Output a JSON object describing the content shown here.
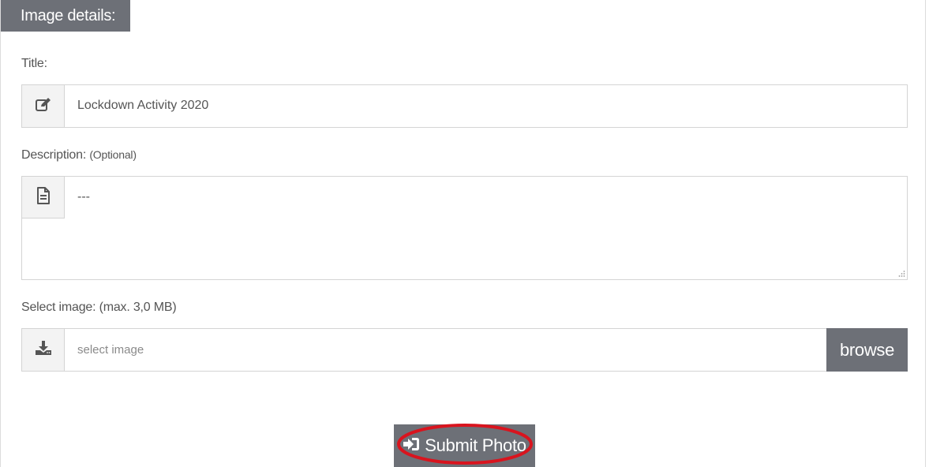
{
  "section": {
    "title": "Image details:"
  },
  "title_field": {
    "label": "Title:",
    "value": "Lockdown Activity 2020",
    "icon": "edit-icon"
  },
  "description_field": {
    "label": "Description:",
    "optional_label": "(Optional)",
    "value": "---",
    "icon": "document-icon"
  },
  "image_field": {
    "label": "Select image: (max. 3,0 MB)",
    "placeholder": "select image",
    "icon": "download-icon",
    "browse_label": "browse"
  },
  "submit": {
    "label": "Submit Photo",
    "icon": "sign-in-icon",
    "highlight_color": "#d9141e"
  },
  "colors": {
    "header_bg": "#6d7077",
    "button_bg": "#6d7077",
    "addon_bg": "#f3f3f3",
    "border": "#d4d4d4"
  }
}
